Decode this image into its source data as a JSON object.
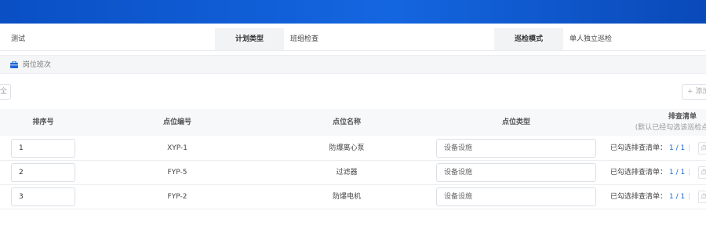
{
  "header": {
    "name_value": "测试",
    "plan_type_label": "计划类型",
    "plan_type_value": "班组检查",
    "patrol_mode_label": "巡检模式",
    "patrol_mode_value": "单人独立巡检"
  },
  "section": {
    "title": "岗位班次",
    "icon": "briefcase-icon"
  },
  "toolbar": {
    "left_button_label": "全",
    "add_button_label": "+ 添加"
  },
  "table": {
    "columns": {
      "seq": "排序号",
      "code": "点位编号",
      "name": "点位名称",
      "type": "点位类型",
      "checklist": "排查清单",
      "checklist_hint": "(默认已经勾选该巡检点下所有"
    },
    "rows": [
      {
        "seq": "1",
        "code": "XYP-1",
        "name": "防爆离心泵",
        "type": "设备设施",
        "check_label": "已勾选排查清单：",
        "check_count": "1 / 1",
        "more": "点"
      },
      {
        "seq": "2",
        "code": "FYP-5",
        "name": "过滤器",
        "type": "设备设施",
        "check_label": "已勾选排查清单：",
        "check_count": "1 / 1",
        "more": "点"
      },
      {
        "seq": "3",
        "code": "FYP-2",
        "name": "防爆电机",
        "type": "设备设施",
        "check_label": "已勾选排查清单：",
        "check_count": "1 / 1",
        "more": "点"
      }
    ]
  },
  "colors": {
    "accent": "#1a66d6",
    "topbar": "#0a4fc4"
  }
}
